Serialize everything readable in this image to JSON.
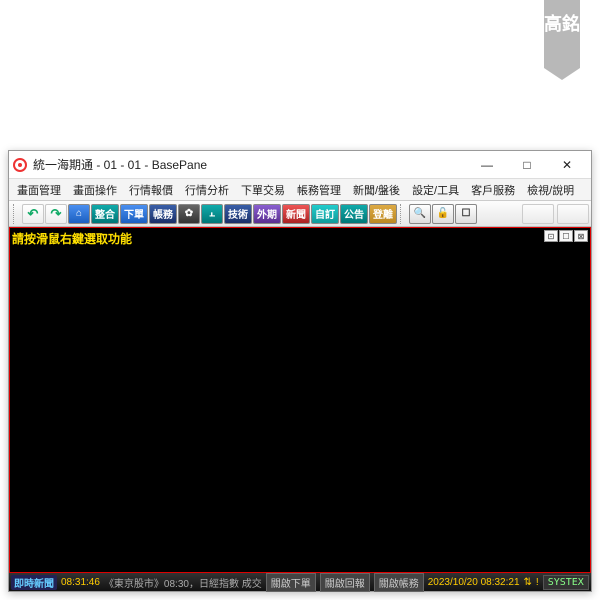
{
  "bookmark": "高銘",
  "window": {
    "title": "統一海期通 - 01 - 01 - BasePane",
    "controls": {
      "min": "—",
      "max": "□",
      "close": "✕"
    }
  },
  "menu": [
    "畫面管理",
    "畫面操作",
    "行情報價",
    "行情分析",
    "下單交易",
    "帳務管理",
    "新聞/盤後",
    "設定/工具",
    "客戶服務",
    "檢視/說明"
  ],
  "toolbar": {
    "back": "↶",
    "fwd": "↷",
    "buttons": [
      {
        "name": "home",
        "label": "⌂",
        "cls": "c-blue"
      },
      {
        "name": "integrate",
        "label": "整合",
        "cls": "c-teal"
      },
      {
        "name": "order",
        "label": "下單",
        "cls": "c-blue"
      },
      {
        "name": "account",
        "label": "帳務",
        "cls": "c-navy"
      },
      {
        "name": "settings",
        "label": "✿",
        "cls": "c-dgray"
      },
      {
        "name": "chart",
        "label": "⫠",
        "cls": "c-teal"
      },
      {
        "name": "tech",
        "label": "技術",
        "cls": "c-navy"
      },
      {
        "name": "foreign",
        "label": "外期",
        "cls": "c-purp"
      },
      {
        "name": "news",
        "label": "新聞",
        "cls": "c-red"
      },
      {
        "name": "custom",
        "label": "自訂",
        "cls": "c-cyan"
      },
      {
        "name": "notice",
        "label": "公告",
        "cls": "c-teal"
      },
      {
        "name": "logout",
        "label": "登離",
        "cls": "c-gold"
      }
    ],
    "extras": [
      {
        "name": "search",
        "label": "🔍"
      },
      {
        "name": "lock",
        "label": "🔓"
      },
      {
        "name": "mini",
        "label": "☐"
      }
    ]
  },
  "content": {
    "hint": "請按滑鼠右鍵選取功能",
    "mini": [
      "⊡",
      "☐",
      "⊠"
    ]
  },
  "status": {
    "label": "即時新聞",
    "time1": "08:31:46",
    "ticker": "《東京股市》08:30，日經指數 成交",
    "btn1": "關啟下單",
    "btn2": "關啟回報",
    "btn3": "關啟帳務",
    "datetime": "2023/10/20 08:32:21",
    "brand": "SYSTEX"
  }
}
